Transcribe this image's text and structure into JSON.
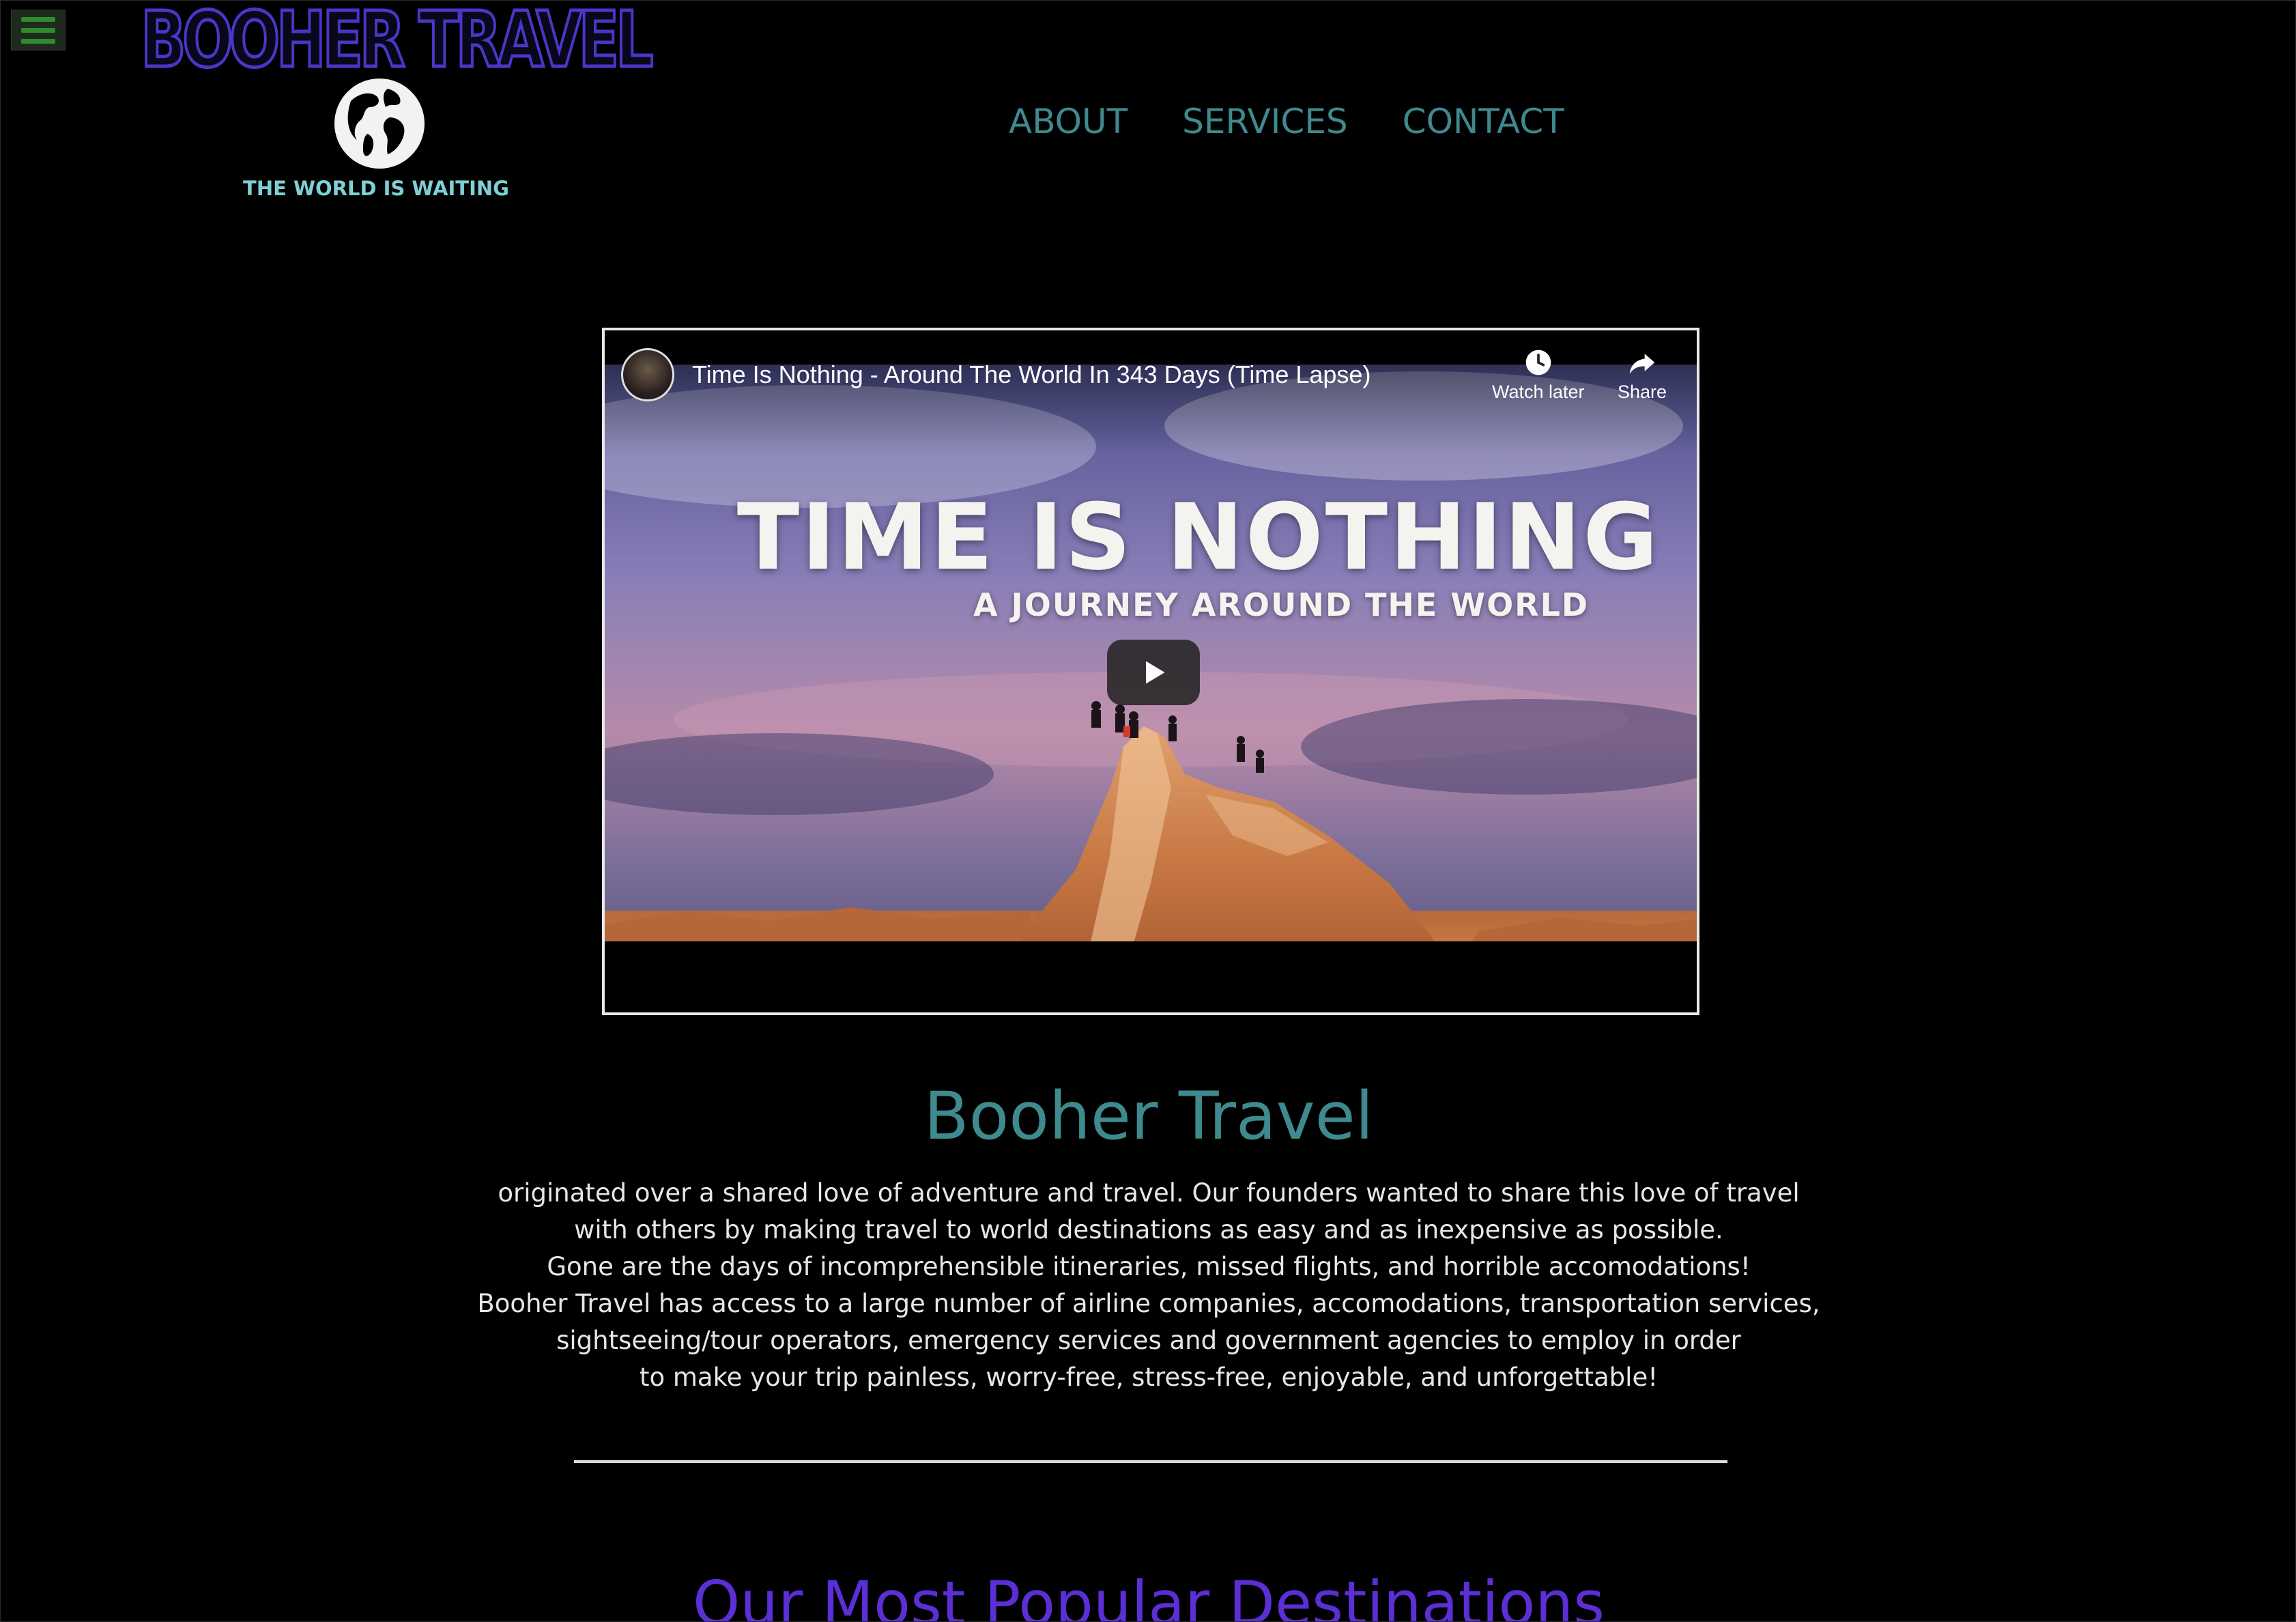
{
  "menu": {
    "icon": "hamburger-menu-icon"
  },
  "logo": {
    "title": "BOOHER TRAVEL",
    "tagline": "THE WORLD IS WAITING",
    "icon": "globe-icon"
  },
  "nav": {
    "items": [
      {
        "label": "ABOUT"
      },
      {
        "label": "SERVICES"
      },
      {
        "label": "CONTACT"
      }
    ]
  },
  "video": {
    "title": "Time Is Nothing - Around The World In 343 Days (Time Lapse)",
    "watch_later_label": "Watch later",
    "share_label": "Share",
    "thumbnail_title": "TIME IS NOTHING",
    "thumbnail_subtitle": "A JOURNEY AROUND THE WORLD",
    "play_icon": "play-icon"
  },
  "intro": {
    "heading": "Booher Travel",
    "lines": [
      "originated over a shared love of adventure and travel. Our founders wanted to share this love of travel",
      "with others by making travel to world destinations as easy and as inexpensive as possible.",
      "Gone are the days of incomprehensible itineraries, missed flights, and horrible accomodations!",
      "Booher Travel has access to a large number of airline companies, accomodations, transportation services,",
      "sightseeing/tour operators, emergency services and government agencies to employ in order",
      "to make your trip painless, worry-free, stress-free, enjoyable, and unforgettable!"
    ]
  },
  "popular": {
    "heading": "Our Most Popular Destinations"
  },
  "colors": {
    "background": "#000000",
    "nav_teal": "#3e8a8e",
    "logo_purple": "#4a36c8",
    "tagline_cyan": "#7ed0d6",
    "hamburger_green": "#2e8b2e",
    "popular_purple": "#5b2ed6"
  }
}
